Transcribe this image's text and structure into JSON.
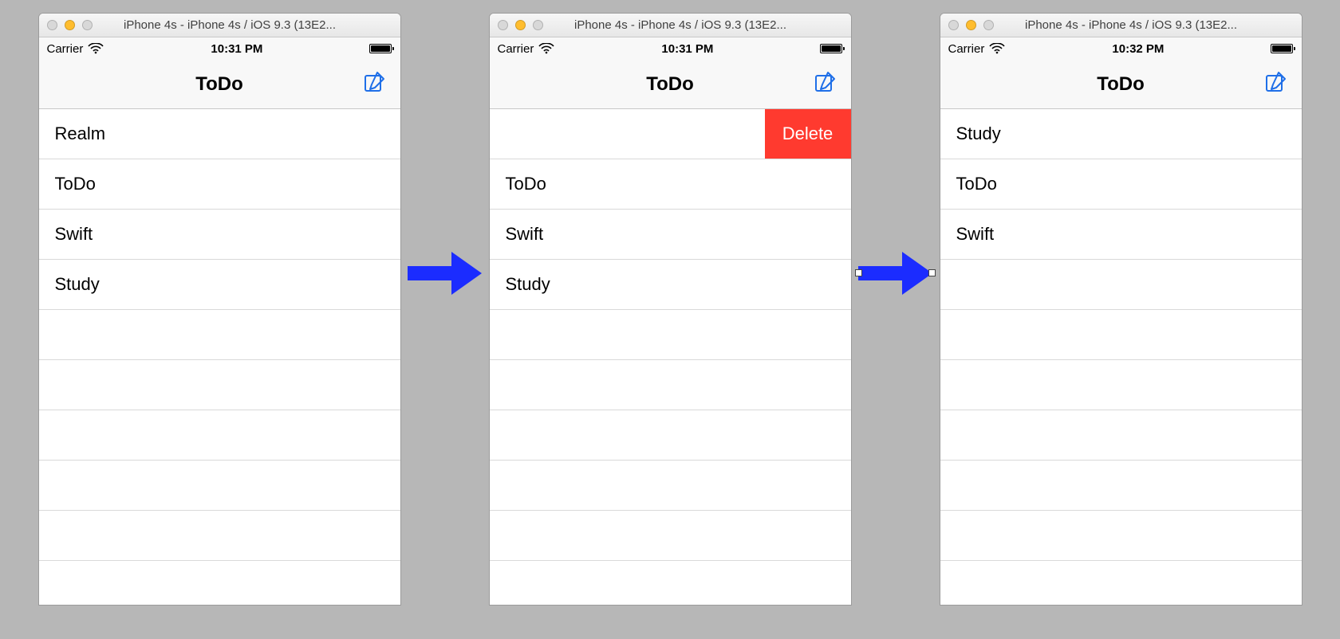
{
  "simulators": [
    {
      "window_title": "iPhone 4s - iPhone 4s / iOS 9.3 (13E2...",
      "status": {
        "carrier": "Carrier",
        "time": "10:31 PM"
      },
      "nav_title": "ToDo",
      "rows": [
        "Realm",
        "ToDo",
        "Swift",
        "Study",
        "",
        "",
        "",
        "",
        ""
      ],
      "swipe_delete": {
        "visible": false,
        "label": "Delete",
        "row": 0
      }
    },
    {
      "window_title": "iPhone 4s - iPhone 4s / iOS 9.3 (13E2...",
      "status": {
        "carrier": "Carrier",
        "time": "10:31 PM"
      },
      "nav_title": "ToDo",
      "rows": [
        "",
        "ToDo",
        "Swift",
        "Study",
        "",
        "",
        "",
        "",
        ""
      ],
      "swipe_delete": {
        "visible": true,
        "label": "Delete",
        "row": 0
      }
    },
    {
      "window_title": "iPhone 4s - iPhone 4s / iOS 9.3 (13E2...",
      "status": {
        "carrier": "Carrier",
        "time": "10:32 PM"
      },
      "nav_title": "ToDo",
      "rows": [
        "Study",
        "ToDo",
        "Swift",
        "",
        "",
        "",
        "",
        "",
        ""
      ],
      "swipe_delete": {
        "visible": false,
        "label": "Delete",
        "row": 0
      }
    }
  ],
  "arrows": [
    {
      "handles": false
    },
    {
      "handles": true
    }
  ]
}
